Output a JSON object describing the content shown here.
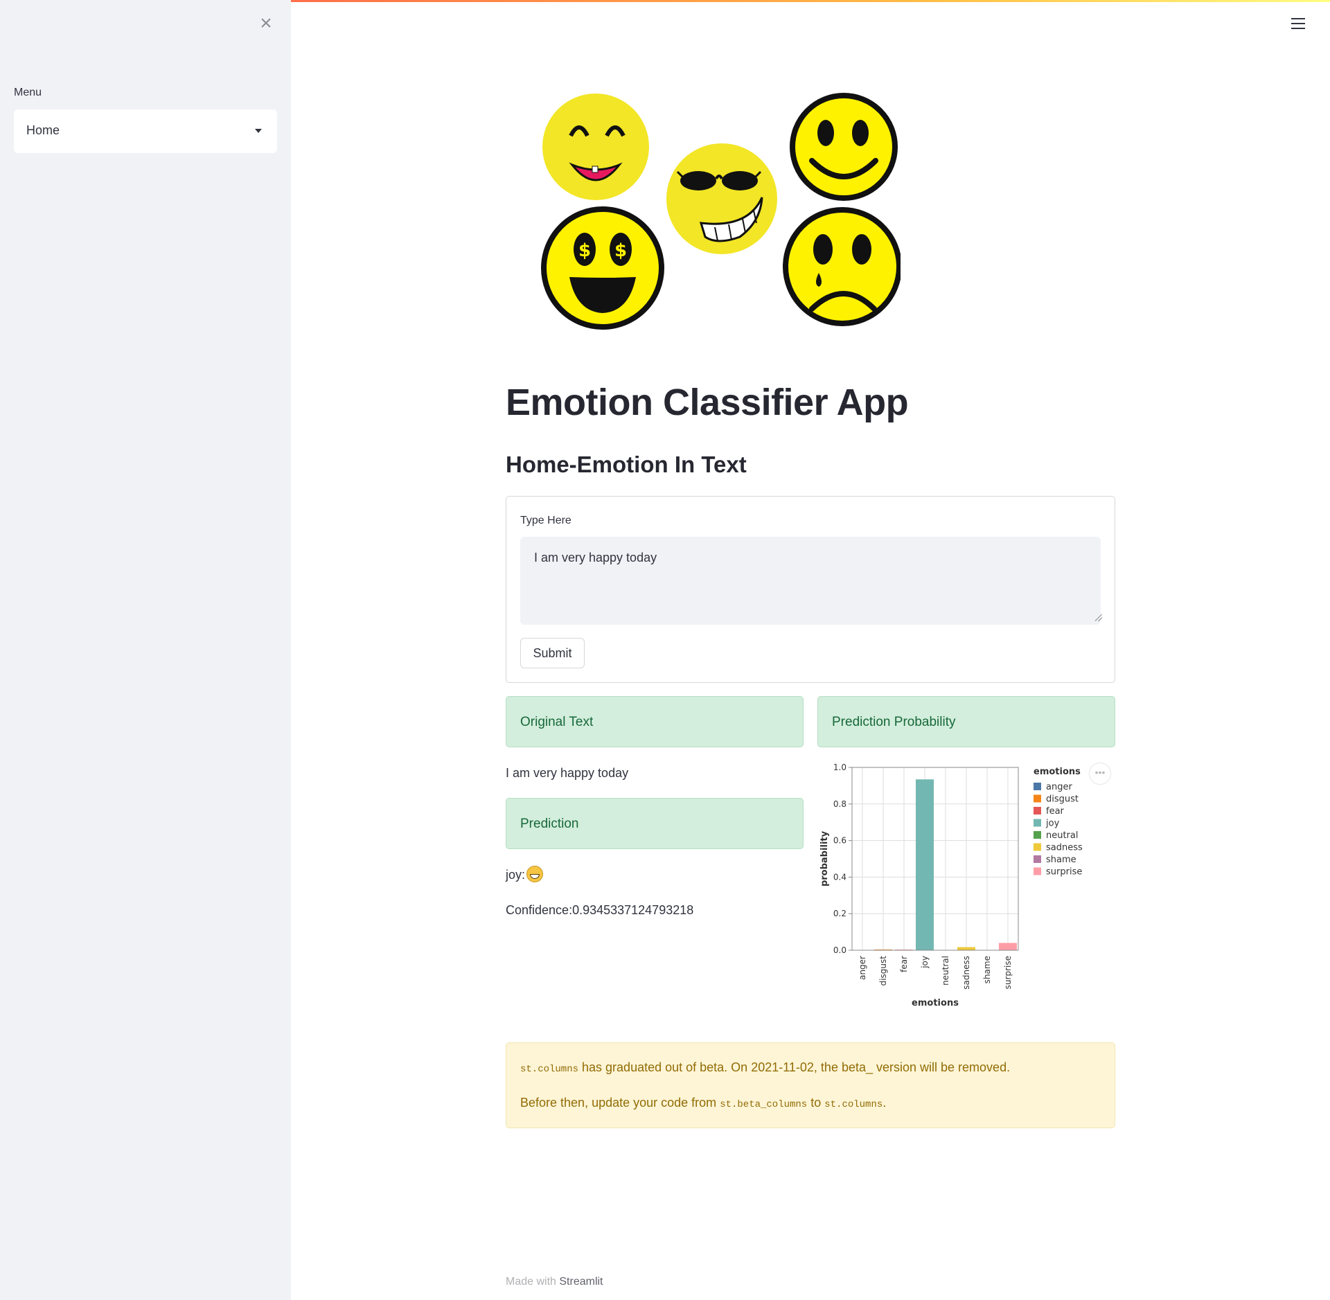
{
  "sidebar": {
    "close_icon": "close-icon",
    "menu_label": "Menu",
    "menu_value": "Home"
  },
  "header": {
    "menu_icon": "hamburger-icon"
  },
  "main": {
    "title": "Emotion Classifier App",
    "subheader": "Home-Emotion In Text",
    "form": {
      "label": "Type Here",
      "text_value": "I am very happy today",
      "submit_label": "Submit"
    },
    "results": {
      "original_title": "Original Text",
      "original_text": "I am very happy today",
      "prediction_title": "Prediction",
      "prediction_label": "joy:",
      "prediction_emoji": "grinning-face-icon",
      "confidence": "Confidence:0.9345337124793218",
      "probability_title": "Prediction Probability"
    },
    "warning": {
      "code_columns": "st.columns",
      "line1_rest": " has graduated out of beta. On 2021-11-02, the beta_ version will be removed.",
      "line2_prefix": "Before then, update your code from ",
      "code_beta_columns": "st.beta_columns",
      "line2_mid": " to ",
      "code_columns_2": "st.columns",
      "line2_end": "."
    },
    "footer": {
      "prefix": "Made with ",
      "link": "Streamlit"
    }
  },
  "colors": {
    "accent_gradient_start": "#ff4b4b",
    "success_bg": "#d3eedc",
    "success_text": "#17683a",
    "warning_bg": "#fdf5d6",
    "warning_text": "#926c05"
  },
  "chart_data": {
    "type": "bar",
    "categories": [
      "anger",
      "disgust",
      "fear",
      "joy",
      "neutral",
      "sadness",
      "shame",
      "surprise"
    ],
    "values": [
      0.001,
      0.004,
      0.003,
      0.9345,
      0.001,
      0.017,
      0.001,
      0.04
    ],
    "colors": [
      "#4c78a8",
      "#f58518",
      "#e45756",
      "#72b7b2",
      "#54a24b",
      "#eeca3b",
      "#b279a2",
      "#ff9da6"
    ],
    "xlabel": "emotions",
    "ylabel": "probability",
    "ylim": [
      0,
      1.0
    ],
    "yticks": [
      "0.0",
      "0.2",
      "0.4",
      "0.6",
      "0.8",
      "1.0"
    ],
    "legend_title": "emotions",
    "legend_placement": "right",
    "grid": true
  }
}
